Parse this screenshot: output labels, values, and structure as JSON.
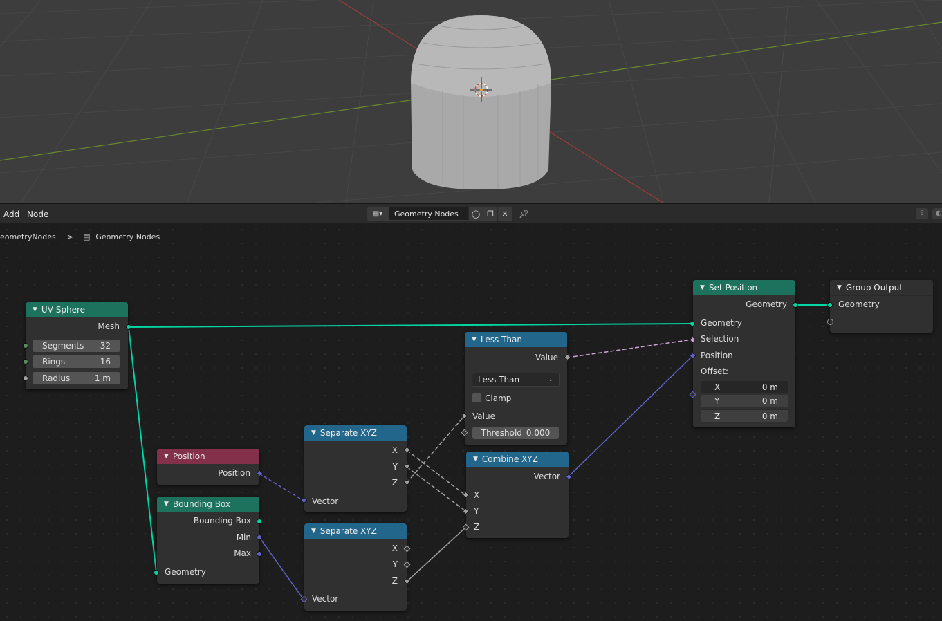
{
  "header": {
    "menu_add": "Add",
    "menu_node": "Node",
    "tree_name": "Geometry Nodes"
  },
  "breadcrumb": {
    "parent": "eometryNodes",
    "separator": ">",
    "current": "Geometry Nodes"
  },
  "nodes": {
    "uv_sphere": {
      "title": "UV Sphere",
      "mesh": "Mesh",
      "segments_label": "Segments",
      "segments_value": "32",
      "rings_label": "Rings",
      "rings_value": "16",
      "radius_label": "Radius",
      "radius_value": "1 m"
    },
    "set_position": {
      "title": "Set Position",
      "out_geometry": "Geometry",
      "in_geometry": "Geometry",
      "selection": "Selection",
      "position": "Position",
      "offset": "Offset:",
      "x_label": "X",
      "x_value": "0 m",
      "y_label": "Y",
      "y_value": "0 m",
      "z_label": "Z",
      "z_value": "0 m"
    },
    "group_output": {
      "title": "Group Output",
      "geometry": "Geometry"
    },
    "less_than": {
      "title": "Less Than",
      "out_value": "Value",
      "operation": "Less Than",
      "clamp": "Clamp",
      "in_value": "Value",
      "threshold_label": "Threshold",
      "threshold_value": "0.000"
    },
    "combine_xyz": {
      "title": "Combine XYZ",
      "vector": "Vector",
      "x": "X",
      "y": "Y",
      "z": "Z"
    },
    "separate_xyz_1": {
      "title": "Separate XYZ",
      "x": "X",
      "y": "Y",
      "z": "Z",
      "vector": "Vector"
    },
    "separate_xyz_2": {
      "title": "Separate XYZ",
      "x": "X",
      "y": "Y",
      "z": "Z",
      "vector": "Vector"
    },
    "position": {
      "title": "Position",
      "position": "Position"
    },
    "bounding_box": {
      "title": "Bounding Box",
      "bounding_box": "Bounding Box",
      "min": "Min",
      "max": "Max",
      "geometry": "Geometry"
    }
  },
  "colors": {
    "geometry_header": "#1d725e",
    "vector_header": "#23668c",
    "input_header": "#83314a",
    "geometry_socket": "#00d6a3",
    "vector_socket": "#6363c7",
    "float_socket": "#a1a1a1",
    "bool_socket": "#cca6d6"
  },
  "icons": [
    "chevron-down-icon",
    "node-tree-icon",
    "shield-icon",
    "duplicate-icon",
    "close-icon",
    "pin-icon",
    "parent-icon"
  ]
}
